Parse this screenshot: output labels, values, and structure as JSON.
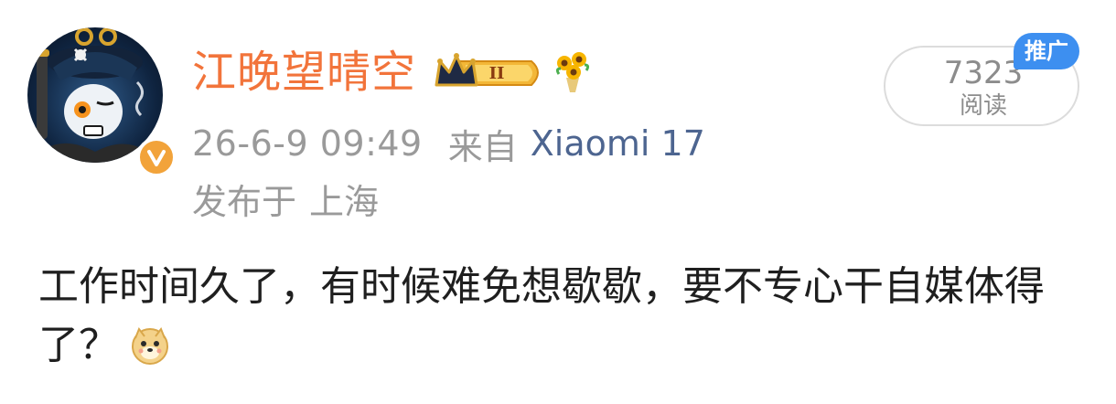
{
  "post": {
    "author": {
      "name": "江晚望晴空",
      "avatar_icon": "avatar-skull-pirate",
      "verified_icon": "verified-v-icon",
      "member_badge_icon": "crown-level-badge",
      "member_badge_level": "II",
      "flower_icon": "sunflower-bouquet-icon"
    },
    "meta": {
      "time": "26-6-9 09:49",
      "from_label": "来自",
      "device": "Xiaomi 17",
      "location_label": "发布于",
      "location": "上海"
    },
    "reads": {
      "count": "7323",
      "label": "阅读",
      "promo_tag": "推广"
    },
    "body": {
      "text": "工作时间久了，有时候难免想歇歇，要不专心干自媒体得了？",
      "emoji_icon": "doge-emoji"
    }
  },
  "colors": {
    "name": "#f2743b",
    "device": "#4d6590",
    "meta": "#9a9a9a",
    "promo": "#3d8ff0",
    "verified": "#f2a33a"
  }
}
